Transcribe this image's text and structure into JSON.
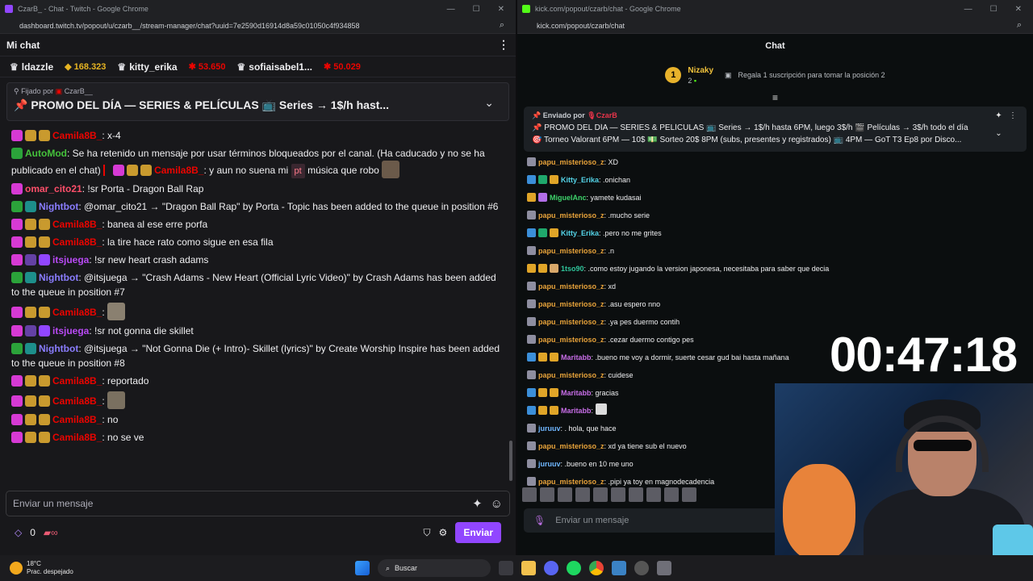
{
  "left_window": {
    "title": "CzarB_ - Chat - Twitch - Google Chrome",
    "url": "dashboard.twitch.tv/popout/u/czarb__/stream-manager/chat?uuid=7e2590d16914d8a59c01050c4f934858",
    "header": "Mi chat",
    "leaderboard": [
      {
        "user": "ldazzle",
        "value": ""
      },
      {
        "user": "",
        "value": "168.323"
      },
      {
        "user": "kitty_erika",
        "value": ""
      },
      {
        "user": "",
        "value": "53.650"
      },
      {
        "user": "sofiaisabel1...",
        "value": ""
      },
      {
        "user": "",
        "value": "50.029"
      }
    ],
    "pinned_by": "Fijado por",
    "pinned_user": "CzarB__",
    "pinned_text": "📌 PROMO DEL DÍA — SERIES & PELÍCULAS 📺 Series → 1$/h hast...",
    "messages": [
      {
        "name": "Camila8B_",
        "text": ": x-4",
        "color": "#eb0400"
      },
      {
        "name": "AutoMod",
        "text": ": Se ha retenido un mensaje por usar términos bloqueados por el canal. (Ha caducado y no se ha publicado en el chat)",
        "color": "#45c23b"
      },
      {
        "name": "Camila8B_",
        "text": ": y aun no suena mi",
        "tag": "pt",
        "tail": "música que robo",
        "color": "#eb0400"
      },
      {
        "name": "omar_cito21",
        "text": ": !sr Porta - Dragon Ball Rap",
        "color": "#ff4f6a"
      },
      {
        "name": "Nightbot",
        "text": ": @omar_cito21 → \"Dragon Ball Rap\" by Porta - Topic has been added to the queue in position #6",
        "color": "#8a7dff"
      },
      {
        "name": "Camila8B_",
        "text": ": banea al ese erre porfa",
        "color": "#eb0400"
      },
      {
        "name": "Camila8B_",
        "text": ": la tire hace rato como sigue en esa fila",
        "color": "#eb0400"
      },
      {
        "name": "itsjuega",
        "text": ": !sr new heart crash adams",
        "color": "#b94af5"
      },
      {
        "name": "Nightbot",
        "text": ": @itsjuega → \"Crash Adams - New Heart (Official Lyric Video)\" by Crash Adams has been added to the queue in position #7",
        "color": "#8a7dff"
      },
      {
        "name": "Camila8B_",
        "text": ":",
        "color": "#eb0400"
      },
      {
        "name": "itsjuega",
        "text": ": !sr not gonna die skillet",
        "color": "#b94af5"
      },
      {
        "name": "Nightbot",
        "text": ": @itsjuega → \"Not Gonna Die (+ Intro)- Skillet (lyrics)\" by Create Worship Inspire has been added to the queue in position #8",
        "color": "#8a7dff"
      },
      {
        "name": "Camila8B_",
        "text": ": reportado",
        "color": "#eb0400"
      },
      {
        "name": "Camila8B_",
        "text": ":",
        "color": "#eb0400"
      },
      {
        "name": "Camila8B_",
        "text": ": no",
        "color": "#eb0400"
      },
      {
        "name": "Camila8B_",
        "text": ": no se ve",
        "color": "#eb0400"
      }
    ],
    "input_placeholder": "Enviar un mensaje",
    "points": "0",
    "send_label": "Enviar"
  },
  "right_window": {
    "title": "kick.com/popout/czarb/chat - Google Chrome",
    "url": "kick.com/popout/czarb/chat",
    "header": "Chat",
    "gift_rank": "1",
    "gift_user": "Nizaky",
    "gift_count": "2",
    "gift_cta": "Regala 1 suscripción para tomar la posición 2",
    "pinned_by": "Enviado por",
    "pinned_user": "CzarB",
    "pinned_line1": "📌 PROMO DEL DÍA — SERIES & PELÍCULAS 📺 Series → 1$/h hasta 6PM, luego 3$/h 🎬 Películas → 3$/h todo el día",
    "pinned_line2": "🎯 Torneo Valorant 6PM — 10$ 💵 Sorteo 20$ 8PM (subs, presentes y registrados) 📺 4PM — GoT T3 Ep8 por Disco...",
    "messages": [
      {
        "name": "papu_misterioso_z",
        "text": ": XD",
        "color": "#e8a33a"
      },
      {
        "name": "Kitty_Erika",
        "text": ": .onichan",
        "color": "#54d4e8"
      },
      {
        "name": "MiguelAnc",
        "text": ": yamete kudasai",
        "color": "#3ed36b"
      },
      {
        "name": "papu_misterioso_z",
        "text": ": .mucho serie",
        "color": "#e8a33a"
      },
      {
        "name": "Kitty_Erika",
        "text": ": .pero no me grites",
        "color": "#54d4e8"
      },
      {
        "name": "papu_misterioso_z",
        "text": ": .n",
        "color": "#e8a33a"
      },
      {
        "name": "1tso90",
        "text": ": .como estoy jugando la version japonesa, necesitaba para saber que decia",
        "color": "#2fc59b"
      },
      {
        "name": "papu_misterioso_z",
        "text": ": xd",
        "color": "#e8a33a"
      },
      {
        "name": "papu_misterioso_z",
        "text": ": .asu espero nno",
        "color": "#e8a33a"
      },
      {
        "name": "papu_misterioso_z",
        "text": ": .ya pes duermo contih",
        "color": "#e8a33a"
      },
      {
        "name": "papu_misterioso_z",
        "text": ": .cezar duermo contigo pes",
        "color": "#e8a33a"
      },
      {
        "name": "Maritabb",
        "text": ": .bueno me voy a dormir, suerte cesar gud bai hasta mañana",
        "color": "#c86ee8"
      },
      {
        "name": "papu_misterioso_z",
        "text": ": cuidese",
        "color": "#e8a33a"
      },
      {
        "name": "Maritabb",
        "text": ": gracias",
        "color": "#c86ee8"
      },
      {
        "name": "Maritabb",
        "text": ":",
        "color": "#c86ee8"
      },
      {
        "name": "juruuv",
        "text": ": . hola, que hace",
        "color": "#6fb6ff"
      },
      {
        "name": "papu_misterioso_z",
        "text": ": xd ya tiene sub el nuevo",
        "color": "#e8a33a"
      },
      {
        "name": "juruuv",
        "text": ": .bueno en 10 me uno",
        "color": "#6fb6ff"
      },
      {
        "name": "papu_misterioso_z",
        "text": ": .pipi ya toy en magnodecadencia",
        "color": "#e8a33a"
      }
    ],
    "input_placeholder": "Enviar un mensaje"
  },
  "overlay": {
    "timer": "00:47:18"
  },
  "taskbar": {
    "temp": "18°C",
    "weather": "Prac. despejado",
    "search_label": "Buscar"
  },
  "colors": {
    "twitch_purple": "#9146ff",
    "kick_green": "#53fc18"
  }
}
